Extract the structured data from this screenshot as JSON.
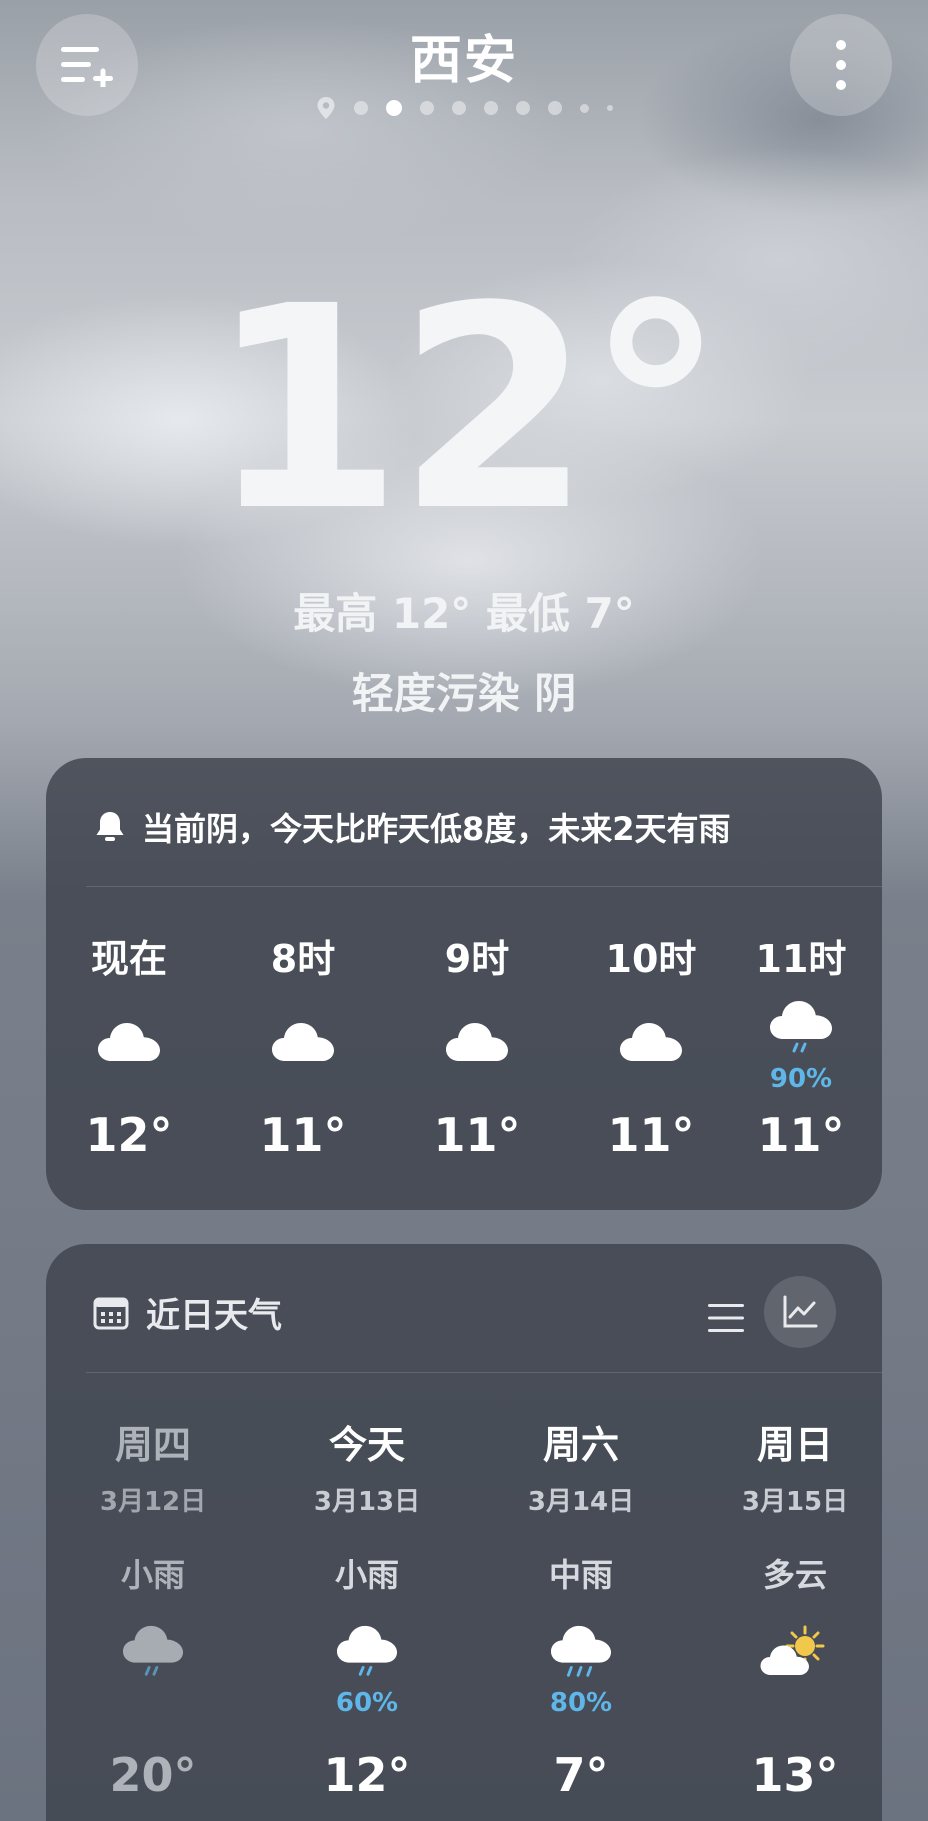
{
  "header": {
    "city": "西安",
    "page_count": 10,
    "active_page": 2
  },
  "current": {
    "temperature": "12°",
    "hi_lo": "最高 12° 最低 7°",
    "condition": "轻度污染  阴"
  },
  "hourly": {
    "alert": "当前阴，今天比昨天低8度，未来2天有雨",
    "hours": [
      {
        "label": "现在",
        "icon": "cloud-icon",
        "precip": "",
        "temp": "12°"
      },
      {
        "label": "8时",
        "icon": "cloud-icon",
        "precip": "",
        "temp": "11°"
      },
      {
        "label": "9时",
        "icon": "cloud-icon",
        "precip": "",
        "temp": "11°"
      },
      {
        "label": "10时",
        "icon": "cloud-icon",
        "precip": "",
        "temp": "11°"
      },
      {
        "label": "11时",
        "icon": "rain-icon",
        "precip": "90%",
        "temp": "11°"
      }
    ]
  },
  "daily": {
    "title": "近日天气",
    "days": [
      {
        "weekday": "周四",
        "date": "3月12日",
        "weather": "小雨",
        "icon": "rain-icon",
        "precip": "",
        "temp": "20°"
      },
      {
        "weekday": "今天",
        "date": "3月13日",
        "weather": "小雨",
        "icon": "rain-icon",
        "precip": "60%",
        "temp": "12°"
      },
      {
        "weekday": "周六",
        "date": "3月14日",
        "weather": "中雨",
        "icon": "rain-icon",
        "precip": "80%",
        "temp": "7°"
      },
      {
        "weekday": "周日",
        "date": "3月15日",
        "weather": "多云",
        "icon": "partly-cloudy-icon",
        "precip": "",
        "temp": "13°"
      }
    ]
  },
  "colors": {
    "precip_blue": "#5fb6e8",
    "card_bg": "#3e434d",
    "sun_yellow": "#f2c84b"
  }
}
